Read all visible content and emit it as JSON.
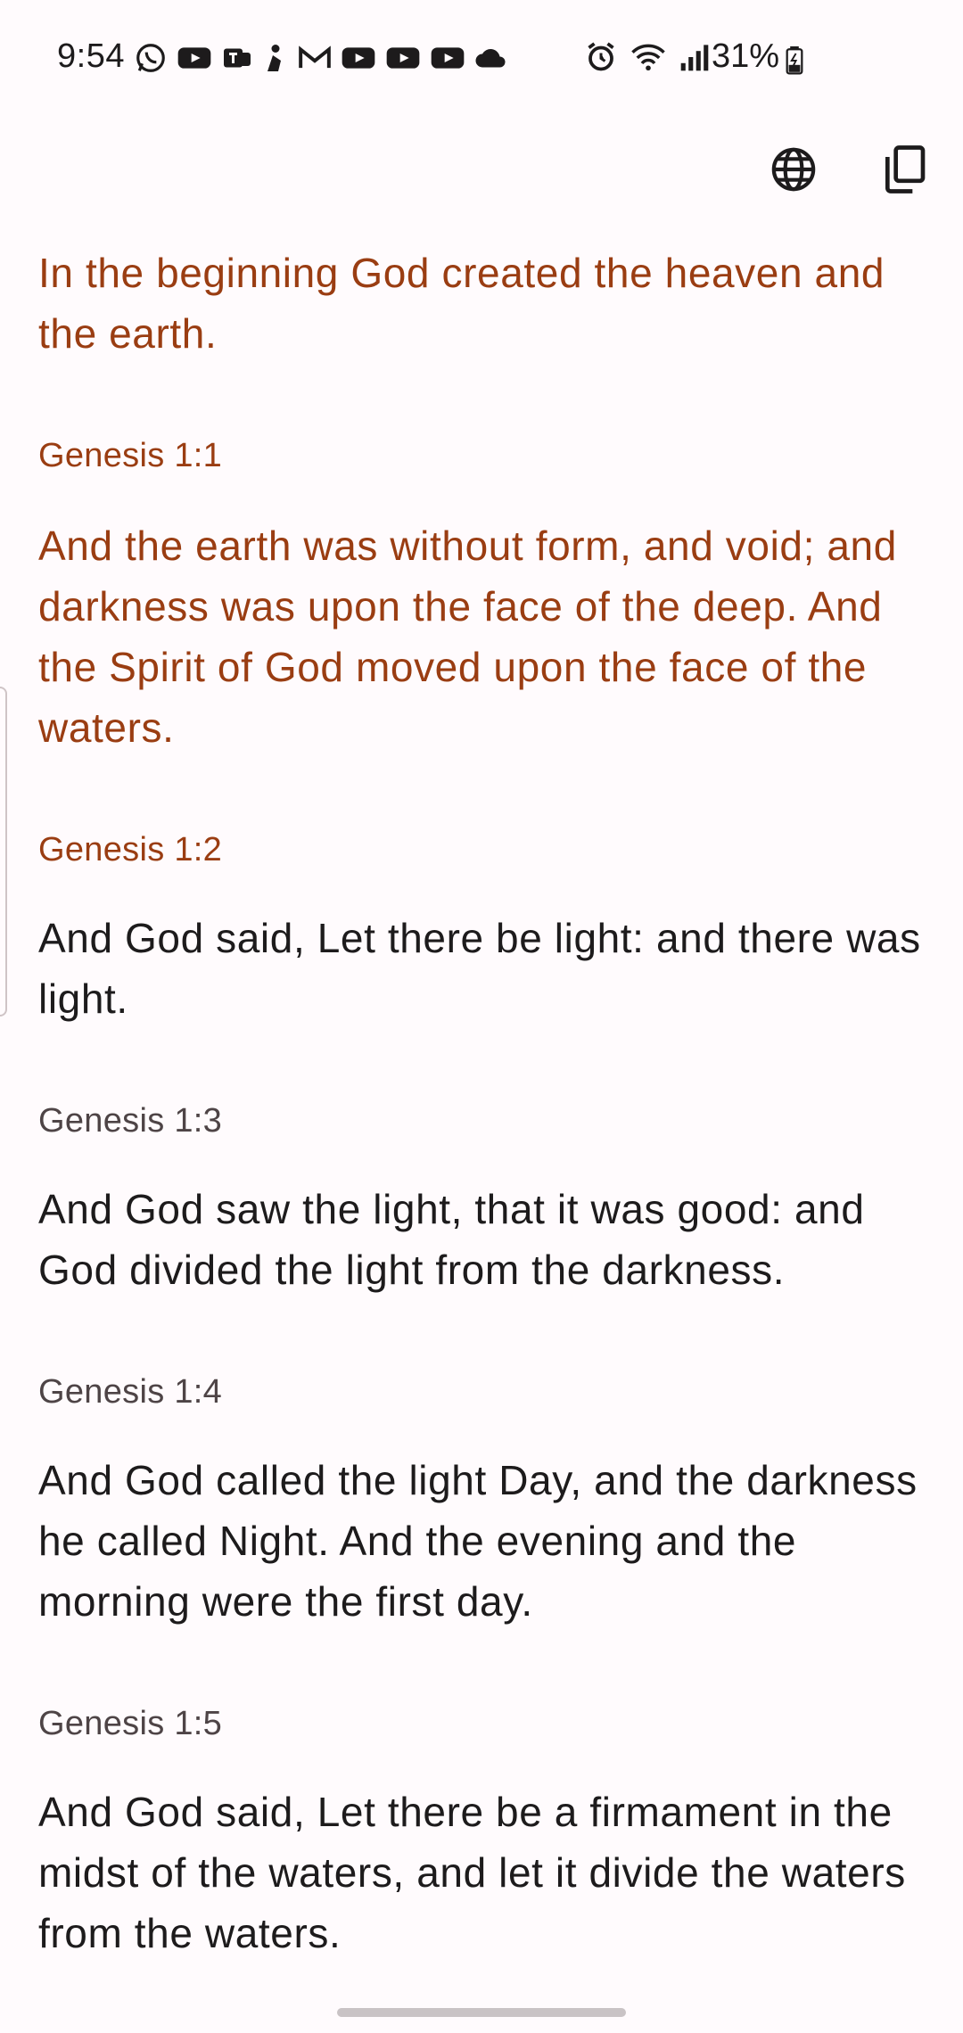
{
  "status_bar": {
    "time": "9:54",
    "battery": "31%",
    "notification_icons": [
      "whatsapp-icon",
      "youtube-icon",
      "teams-icon",
      "bixby-icon",
      "gmail-icon",
      "youtube-icon",
      "youtube-icon",
      "youtube-icon",
      "cloud-icon"
    ],
    "system_icons": [
      "alarm-icon",
      "wifi-icon",
      "signal-icon",
      "battery-charging-icon"
    ]
  },
  "toolbar": {
    "icons": [
      "translate-globe-icon",
      "copy-icon"
    ]
  },
  "colors": {
    "selected_text": "#9a3d12",
    "normal_text": "#1d1b1c",
    "reference_text": "#4e4446",
    "background": "#fffbfd"
  },
  "verses": [
    {
      "text": "In the beginning God created the heaven and the earth.",
      "ref": "Genesis 1:1",
      "selected": true
    },
    {
      "text": "And the earth was without form, and void; and darkness was upon the face of the deep. And the Spirit of God moved upon the face of the waters.",
      "ref": "Genesis 1:2",
      "selected": true
    },
    {
      "text": "And God said, Let there be light: and there was light.",
      "ref": "Genesis 1:3",
      "selected": false
    },
    {
      "text": "And God saw the light, that it was good: and God divided the light from the darkness.",
      "ref": "Genesis 1:4",
      "selected": false
    },
    {
      "text": "And God called the light Day, and the darkness he called Night. And the evening and the morning were the first day.",
      "ref": "Genesis 1:5",
      "selected": false
    },
    {
      "text": "And God said, Let there be a firmament in the midst of the waters, and let it divide the waters from the waters.",
      "ref": "",
      "selected": false
    }
  ]
}
